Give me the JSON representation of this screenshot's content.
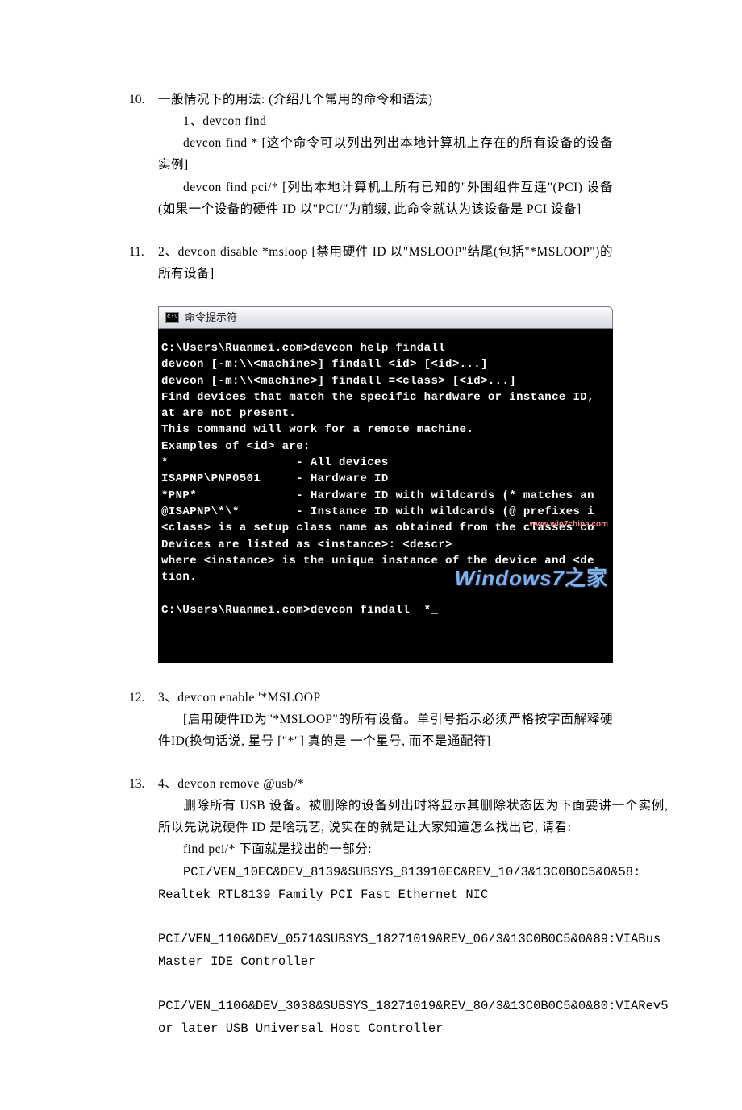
{
  "items": {
    "i10": {
      "num": "10.",
      "line1": "一般情况下的用法: (介绍几个常用的命令和语法)",
      "line2": "1、devcon find",
      "line3": "devcon find * [这个命令可以列出列出本地计算机上存在的所有设备的设备实例]",
      "line4": "devcon find pci/* [列出本地计算机上所有已知的\"外围组件互连\"(PCI) 设备(如果一个设备的硬件 ID 以\"PCI/\"为前缀, 此命令就认为该设备是 PCI 设备]"
    },
    "i11": {
      "num": "11.",
      "text": "2、devcon disable *msloop [禁用硬件 ID 以\"MSLOOP\"结尾(包括\"*MSLOOP\")的所有设备]"
    },
    "i12": {
      "num": "12.",
      "line1": "3、devcon enable '*MSLOOP",
      "line2": "[启用硬件ID为\"*MSLOOP\"的所有设备。单引号指示必须严格按字面解释硬件ID(换句话说, 星号 [\"*\"] 真的是 一个星号, 而不是通配符]"
    },
    "i13": {
      "num": "13.",
      "line1": " 4、devcon remove @usb/*",
      "line2": "删除所有 USB 设备。被删除的设备列出时将显示其删除状态因为下面要讲一个实例, 所以先说说硬件 ID 是啥玩艺, 说实在的就是让大家知道怎么找出它, 请看:",
      "line3": "find pci/* 下面就是找出的一部分:",
      "line4_mono": "PCI/VEN_10EC&DEV_8139&SUBSYS_813910EC&REV_10/3&13C0B0C5&0&58: Realtek RTL8139 Family PCI Fast Ethernet NIC",
      "line5_mono": "PCI/VEN_1106&DEV_0571&SUBSYS_18271019&REV_06/3&13C0B0C5&0&89:VIABus Master IDE Controller",
      "line6_mono": "PCI/VEN_1106&DEV_3038&SUBSYS_18271019&REV_80/3&13C0B0C5&0&80:VIARev5 or later USB Universal Host Controller"
    }
  },
  "terminal": {
    "title": "命令提示符",
    "lines": [
      "C:\\Users\\Ruanmei.com>devcon help findall",
      "devcon [-m:\\\\<machine>] findall <id> [<id>...]",
      "devcon [-m:\\\\<machine>] findall =<class> [<id>...]",
      "Find devices that match the specific hardware or instance ID,",
      "at are not present.",
      "This command will work for a remote machine.",
      "Examples of <id> are:",
      "*                  - All devices",
      "ISAPNP\\PNP0501     - Hardware ID",
      "*PNP*              - Hardware ID with wildcards (* matches an",
      "@ISAPNP\\*\\*        - Instance ID with wildcards (@ prefixes i",
      "<class> is a setup class name as obtained from the classes co",
      "Devices are listed as <instance>: <descr>",
      "where <instance> is the unique instance of the device and <de",
      "tion.",
      "",
      "C:\\Users\\Ruanmei.com>devcon findall  *_"
    ],
    "watermark_url": "www.win7china.com",
    "watermark_logo_en": "Windows7",
    "watermark_logo_zh": "之家"
  }
}
